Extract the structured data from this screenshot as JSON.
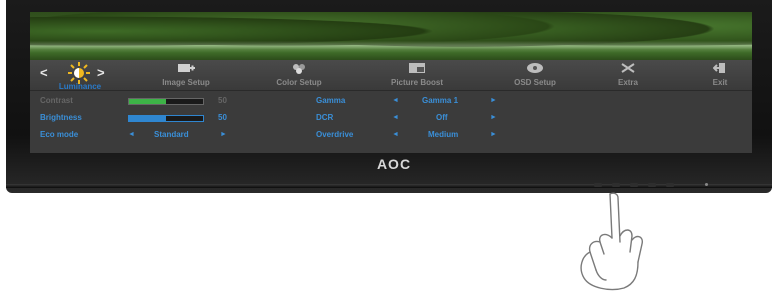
{
  "logo_text": "AOC",
  "tabs": [
    {
      "label": "Luminance",
      "icon": "sun-icon"
    },
    {
      "label": "Image Setup",
      "icon": "image-setup-icon"
    },
    {
      "label": "Color Setup",
      "icon": "color-setup-icon"
    },
    {
      "label": "Picture Boost",
      "icon": "picture-boost-icon"
    },
    {
      "label": "OSD Setup",
      "icon": "osd-setup-icon"
    },
    {
      "label": "Extra",
      "icon": "extra-icon"
    },
    {
      "label": "Exit",
      "icon": "exit-icon"
    }
  ],
  "active_tab_index": 0,
  "nav": {
    "prev": "<",
    "next": ">"
  },
  "settings": {
    "contrast": {
      "label": "Contrast",
      "value": "50",
      "fill_fraction": 0.5
    },
    "brightness": {
      "label": "Brightness",
      "value": "50",
      "fill_fraction": 0.5
    },
    "eco_mode": {
      "label": "Eco mode",
      "value": "Standard"
    },
    "gamma": {
      "label": "Gamma",
      "value": "Gamma 1"
    },
    "dcr": {
      "label": "DCR",
      "value": "Off"
    },
    "overdrive": {
      "label": "Overdrive",
      "value": "Medium"
    }
  },
  "arrows": {
    "left": "◄",
    "right": "►"
  },
  "colors": {
    "accent_blue": "#3a8fd8",
    "contrast_fill": "#3db347",
    "brightness_fill": "#2f86d0"
  }
}
